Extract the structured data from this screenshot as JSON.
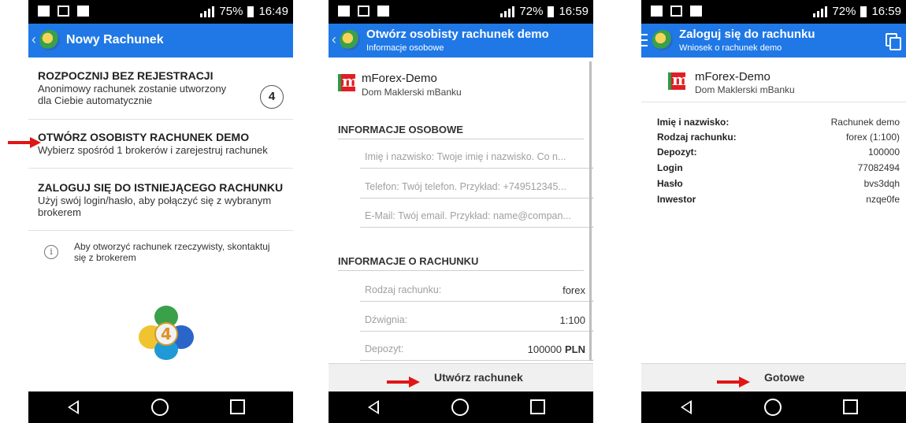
{
  "phones": {
    "p1": {
      "status": {
        "battery": "75%",
        "time": "16:49"
      },
      "title": "Nowy Rachunek",
      "options": [
        {
          "title": "ROZPOCZNIJ BEZ REJESTRACJI",
          "desc": "Anonimowy rachunek zostanie utworzony dla Ciebie automatycznie",
          "badge": "4"
        },
        {
          "title": "OTWÓRZ OSOBISTY RACHUNEK DEMO",
          "desc": "Wybierz spośród 1 brokerów i zarejestruj rachunek"
        },
        {
          "title": "ZALOGUJ SIĘ DO ISTNIEJĄCEGO RACHUNKU",
          "desc": "Użyj swój login/hasło, aby połączyć się z wybranym brokerem"
        }
      ],
      "info": "Aby otworzyć rachunek rzeczywisty, skontaktuj się z brokerem",
      "logo_digit": "4"
    },
    "p2": {
      "status": {
        "battery": "72%",
        "time": "16:59"
      },
      "title": "Otwórz osobisty rachunek demo",
      "subtitle": "Informacje osobowe",
      "broker": {
        "name": "mForex-Demo",
        "company": "Dom Maklerski mBanku"
      },
      "section_personal": "INFORMACJE OSOBOWE",
      "fields": [
        {
          "placeholder": "Imię i nazwisko:  Twoje imię i nazwisko. Co n..."
        },
        {
          "placeholder": "Telefon: Twój telefon. Przykład: +749512345..."
        },
        {
          "placeholder": "E-Mail: Twój email. Przykład: name@compan..."
        }
      ],
      "section_account": "INFORMACJE O RACHUNKU",
      "rows": [
        {
          "label": "Rodzaj rachunku:",
          "value": "forex",
          "unit": ""
        },
        {
          "label": "Dźwignia:",
          "value": "1:100",
          "unit": ""
        },
        {
          "label": "Depozyt:",
          "value": "100000",
          "unit": "PLN"
        }
      ],
      "button": "Utwórz rachunek"
    },
    "p3": {
      "status": {
        "battery": "72%",
        "time": "16:59"
      },
      "title": "Zaloguj się do rachunku",
      "subtitle": "Wniosek o rachunek demo",
      "broker": {
        "name": "mForex-Demo",
        "company": "Dom Maklerski mBanku"
      },
      "details": [
        {
          "key": "Imię i nazwisko:",
          "value": "Rachunek demo"
        },
        {
          "key": "Rodzaj rachunku:",
          "value": "forex (1:100)"
        },
        {
          "key": "Depozyt:",
          "value": "100000"
        },
        {
          "key": "Login",
          "value": "77082494"
        },
        {
          "key": "Hasło",
          "value": "bvs3dqh"
        },
        {
          "key": "Inwestor",
          "value": "nzqe0fe"
        }
      ],
      "button": "Gotowe"
    }
  },
  "colors": {
    "appbar": "#1f78e6",
    "arrow": "#e01515"
  }
}
